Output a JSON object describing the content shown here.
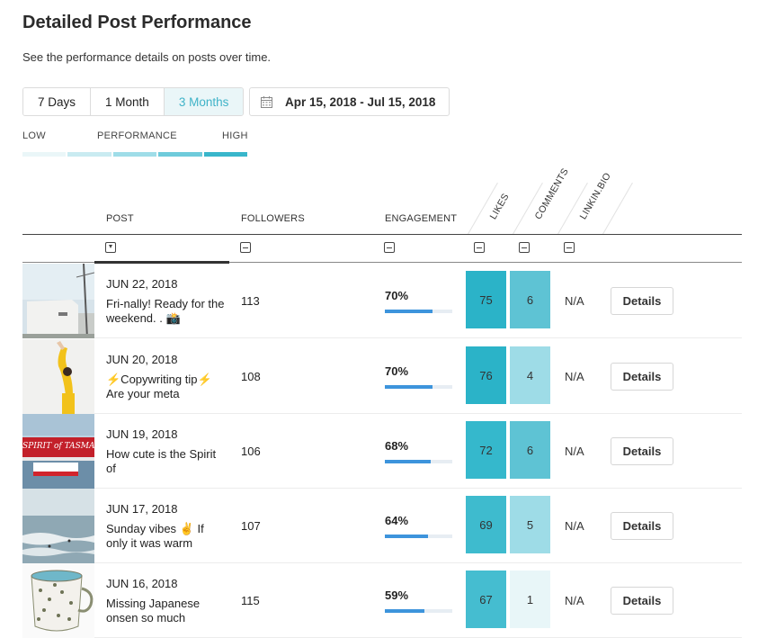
{
  "header": {
    "title": "Detailed Post Performance",
    "subtitle": "See the performance details on posts over time."
  },
  "ranges": [
    {
      "label": "7 Days",
      "active": false
    },
    {
      "label": "1 Month",
      "active": false
    },
    {
      "label": "3 Months",
      "active": true
    }
  ],
  "date_range": {
    "icon": "calendar-icon",
    "label": "Apr 15, 2018 - Jul 15, 2018"
  },
  "legend": {
    "low": "LOW",
    "mid": "PERFORMANCE",
    "high": "HIGH",
    "scale_colors": [
      "#eaf6f8",
      "#c9ebf1",
      "#9fdde8",
      "#6fcbdb",
      "#39b6cb"
    ]
  },
  "columns": {
    "post": "POST",
    "followers": "FOLLOWERS",
    "engagement": "ENGAGEMENT",
    "likes": "LIKES",
    "comments": "COMMENTS",
    "linkinbio": "LINKIN.BIO"
  },
  "colors": {
    "accent": "#3fb3c8",
    "bar_fill": "#3d94dc",
    "heat_dark": "#2bb3c8",
    "heat_mid": "#5ec3d4",
    "heat_light": "#9edce7",
    "heat_faint": "#e8f6f8"
  },
  "rows": [
    {
      "date": "JUN 22, 2018",
      "caption": "Fri-nally! Ready for the weekend. . 📸",
      "followers": "113",
      "engagement": "70%",
      "engagement_value": 70,
      "likes": "75",
      "comments": "6",
      "linkinbio": "N/A",
      "details": "Details",
      "likes_color": "#2bb3c8",
      "comments_color": "#5ec3d4"
    },
    {
      "date": "JUN 20, 2018",
      "caption": "⚡Copywriting tip⚡ Are your meta",
      "followers": "108",
      "engagement": "70%",
      "engagement_value": 70,
      "likes": "76",
      "comments": "4",
      "linkinbio": "N/A",
      "details": "Details",
      "likes_color": "#2bb3c8",
      "comments_color": "#9edce7"
    },
    {
      "date": "JUN 19, 2018",
      "caption": "How cute is the Spirit of",
      "followers": "106",
      "engagement": "68%",
      "engagement_value": 68,
      "likes": "72",
      "comments": "6",
      "linkinbio": "N/A",
      "details": "Details",
      "likes_color": "#35b8cc",
      "comments_color": "#5ec3d4"
    },
    {
      "date": "JUN 17, 2018",
      "caption": "Sunday vibes ✌️ If only it was warm",
      "followers": "107",
      "engagement": "64%",
      "engagement_value": 64,
      "likes": "69",
      "comments": "5",
      "linkinbio": "N/A",
      "details": "Details",
      "likes_color": "#3ebbce",
      "comments_color": "#9edce7"
    },
    {
      "date": "JUN 16, 2018",
      "caption": "Missing Japanese onsen so much",
      "followers": "115",
      "engagement": "59%",
      "engagement_value": 59,
      "likes": "67",
      "comments": "1",
      "linkinbio": "N/A",
      "details": "Details",
      "likes_color": "#45bdd0",
      "comments_color": "#e8f6f8"
    }
  ]
}
